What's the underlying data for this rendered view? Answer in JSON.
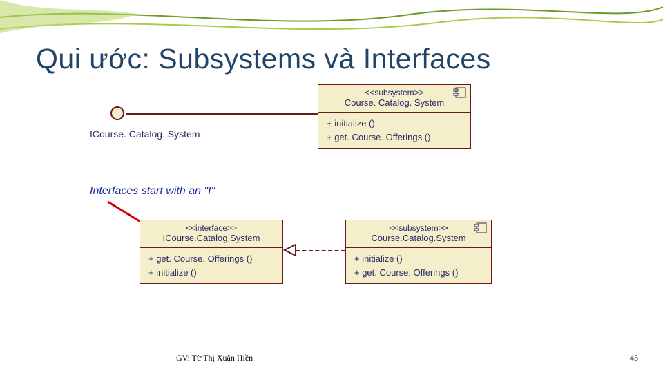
{
  "slide": {
    "title": "Qui ước: Subsystems và Interfaces",
    "footer_author": "GV: Từ Thị Xuân Hiền",
    "page_number": "45"
  },
  "top_diagram": {
    "interface_label": "ICourse. Catalog. System",
    "subsystem": {
      "stereotype": "<<subsystem>>",
      "name": "Course. Catalog. System",
      "ops": [
        "+ initialize ()",
        "+ get. Course. Offerings ()"
      ]
    }
  },
  "note": {
    "text": "Interfaces start with an \"I\""
  },
  "bottom_diagram": {
    "interface_box": {
      "stereotype": "<<interface>>",
      "name": "ICourse.Catalog.System",
      "ops": [
        "+ get. Course. Offerings ()",
        "+ initialize ()"
      ]
    },
    "subsystem_box": {
      "stereotype": "<<subsystem>>",
      "name": "Course.Catalog.System",
      "ops": [
        "+ initialize ()",
        "+ get. Course. Offerings ()"
      ]
    }
  },
  "colors": {
    "box_fill": "#f4eecb",
    "box_border": "#6a1a1a",
    "text_blue": "#2a2a66",
    "arrow_red": "#cc0000"
  }
}
